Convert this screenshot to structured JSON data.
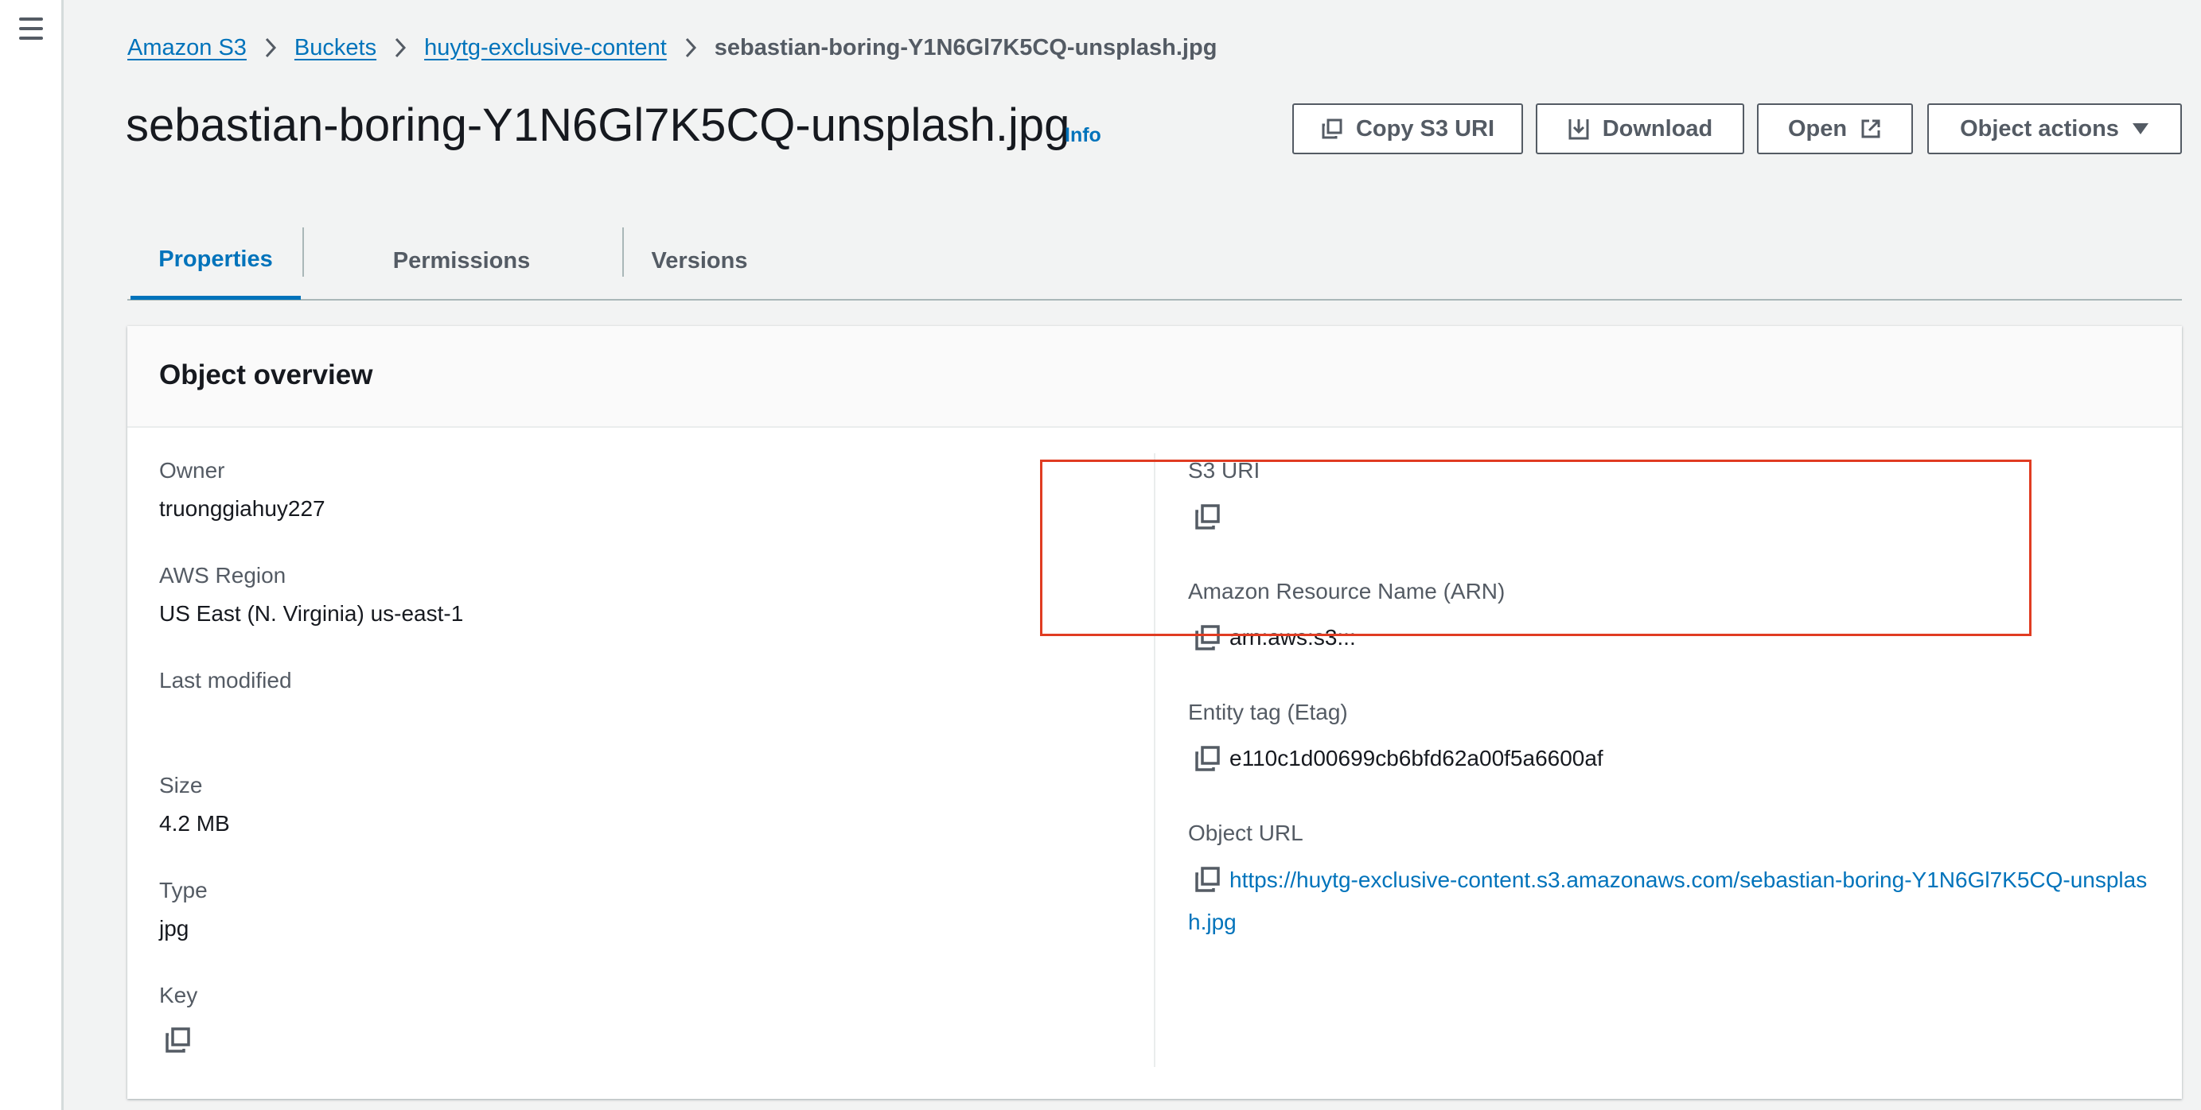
{
  "breadcrumb": {
    "items": [
      "Amazon S3",
      "Buckets",
      "huytg-exclusive-content"
    ],
    "current": "sebastian-boring-Y1N6Gl7K5CQ-unsplash.jpg"
  },
  "header": {
    "title": "sebastian-boring-Y1N6Gl7K5CQ-unsplash.jpg",
    "info_label": "Info",
    "buttons": {
      "copy_uri": "Copy S3 URI",
      "download": "Download",
      "open": "Open",
      "object_actions": "Object actions"
    }
  },
  "tabs": [
    "Properties",
    "Permissions",
    "Versions"
  ],
  "active_tab": "Properties",
  "overview": {
    "title": "Object overview",
    "left": {
      "owner_label": "Owner",
      "owner_value": "truonggiahuy227",
      "region_label": "AWS Region",
      "region_value": "US East (N. Virginia) us-east-1",
      "modified_label": "Last modified",
      "size_label": "Size",
      "size_value": "4.2 MB",
      "type_label": "Type",
      "type_value": "jpg",
      "key_label": "Key"
    },
    "right": {
      "s3uri_label": "S3 URI",
      "arn_label": "Amazon Resource Name (ARN)",
      "arn_value": "arn:aws:s3:::",
      "etag_label": "Entity tag (Etag)",
      "etag_value": "e110c1d00699cb6bfd62a00f5a6600af",
      "url_label": "Object URL",
      "url_value": "https://huytg-exclusive-content.s3.amazonaws.com/sebastian-boring-Y1N6Gl7K5CQ-unsplash.jpg"
    }
  },
  "colors": {
    "link": "#0073bb",
    "text": "#16191f",
    "muted": "#545b64",
    "highlight": "#e03c22",
    "background": "#f2f3f3"
  },
  "icons": [
    "menu-icon",
    "chevron-right-icon",
    "copy-icon",
    "download-icon",
    "external-link-icon",
    "caret-down-icon"
  ]
}
